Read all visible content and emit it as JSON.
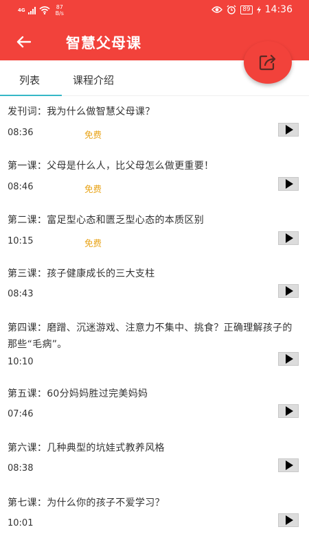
{
  "status_bar": {
    "signal": "4G",
    "net_speed_value": "87",
    "net_speed_unit": "B/s",
    "battery": "89",
    "time": "14:36"
  },
  "header": {
    "title": "智慧父母课",
    "back_icon": "arrow-left-icon",
    "share_icon": "share-icon"
  },
  "tabs": [
    {
      "label": "列表",
      "active": true
    },
    {
      "label": "课程介绍",
      "active": false
    }
  ],
  "accent_colors": {
    "primary": "#f2423b",
    "tab_indicator": "#35b7c6",
    "free_label": "#e8a317"
  },
  "lessons": [
    {
      "title": "发刊词：我为什么做智慧父母课？",
      "duration": "08:36",
      "free": "免费"
    },
    {
      "title": "第一课：父母是什么人，比父母怎么做更重要！",
      "duration": "08:46",
      "free": "免费"
    },
    {
      "title": "第二课：富足型心态和匮乏型心态的本质区别",
      "duration": "10:15",
      "free": "免费"
    },
    {
      "title": "第三课：孩子健康成长的三大支柱",
      "duration": "08:43"
    },
    {
      "title": "第四课：磨蹭、沉迷游戏、注意力不集中、挑食？正确理解孩子的那些“毛病”。",
      "duration": "10:10"
    },
    {
      "title": "第五课：60分妈妈胜过完美妈妈",
      "duration": "07:46"
    },
    {
      "title": "第六课：几种典型的坑娃式教养风格",
      "duration": "08:38"
    },
    {
      "title": "第七课：为什么你的孩子不爱学习？",
      "duration": "10:01"
    }
  ]
}
